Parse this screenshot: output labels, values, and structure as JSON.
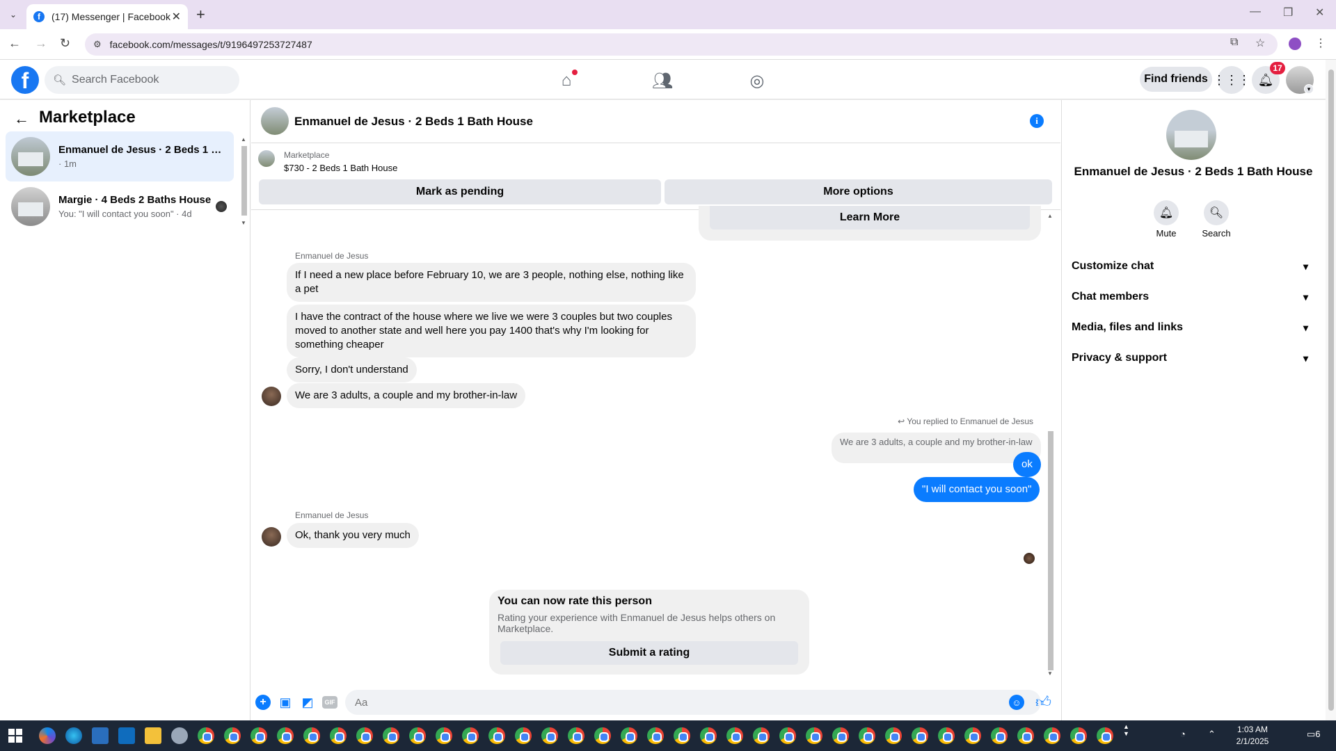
{
  "browser": {
    "tab_title": "(17) Messenger | Facebook",
    "tab_close": "✕",
    "new_tab": "+",
    "url": "facebook.com/messages/t/9196497253727487",
    "win_min": "—",
    "win_restore": "❐",
    "win_close": "✕",
    "back": "←",
    "forward": "→",
    "reload": "↻"
  },
  "facebook": {
    "logo": "f",
    "search_placeholder": "Search Facebook",
    "find_friends": "Find friends",
    "notification_count": "17",
    "icons": [
      "home-icon",
      "friends-icon",
      "groups-icon",
      "menu-grid-icon",
      "bell-icon"
    ]
  },
  "left_panel": {
    "title": "Marketplace",
    "conversations": [
      {
        "name": "Enmanuel de Jesus · 2 Beds 1 Ba...",
        "sub": "· 1m",
        "active": true
      },
      {
        "name": "Margie · 4 Beds 2 Baths House",
        "sub": "You: \"I will contact you soon\" · 4d",
        "active": false
      }
    ]
  },
  "chat": {
    "header_title": "Enmanuel de Jesus · 2 Beds 1 Bath House",
    "info_icon": "i",
    "listing_label": "Marketplace",
    "listing_price": "$730 - 2 Beds 1 Bath House",
    "mark_pending": "Mark as pending",
    "more_options": "More options",
    "learn_more": "Learn More",
    "sender_name": "Enmanuel de Jesus",
    "incoming_1": "If I need a new place before February 10, we are 3 people, nothing else, nothing like a pet",
    "incoming_2": "I have the contract of the house where we live we were 3 couples but two couples moved to another state and well here you pay 1400 that's why I'm looking for something cheaper",
    "incoming_3": "Sorry, I don't understand",
    "incoming_4": "We are 3 adults, a couple and my brother-in-law",
    "replied_label": "You replied to Enmanuel de Jesus",
    "quoted": "We are 3 adults, a couple and my brother-in-law",
    "outgoing_1": "ok",
    "outgoing_2": "\"I will contact you soon\"",
    "sender_name_2": "Enmanuel de Jesus",
    "incoming_5": "Ok, thank you very much",
    "rate_title": "You can now rate this person",
    "rate_desc": "Rating your experience with Enmanuel de Jesus helps others on Marketplace.",
    "rate_button": "Submit a rating",
    "composer_placeholder": "Aa",
    "gif": "GIF"
  },
  "right_panel": {
    "name": "Enmanuel de Jesus · 2 Beds 1 Bath House",
    "mute": "Mute",
    "search": "Search",
    "sections": [
      "Customize chat",
      "Chat members",
      "Media, files and links",
      "Privacy & support"
    ]
  },
  "taskbar": {
    "time": "1:03 AM",
    "date": "2/1/2025",
    "notif_count": "6"
  },
  "colors": {
    "accent": "#0a7cff",
    "facebook_blue": "#1877f2",
    "badge_red": "#e41e3f"
  }
}
